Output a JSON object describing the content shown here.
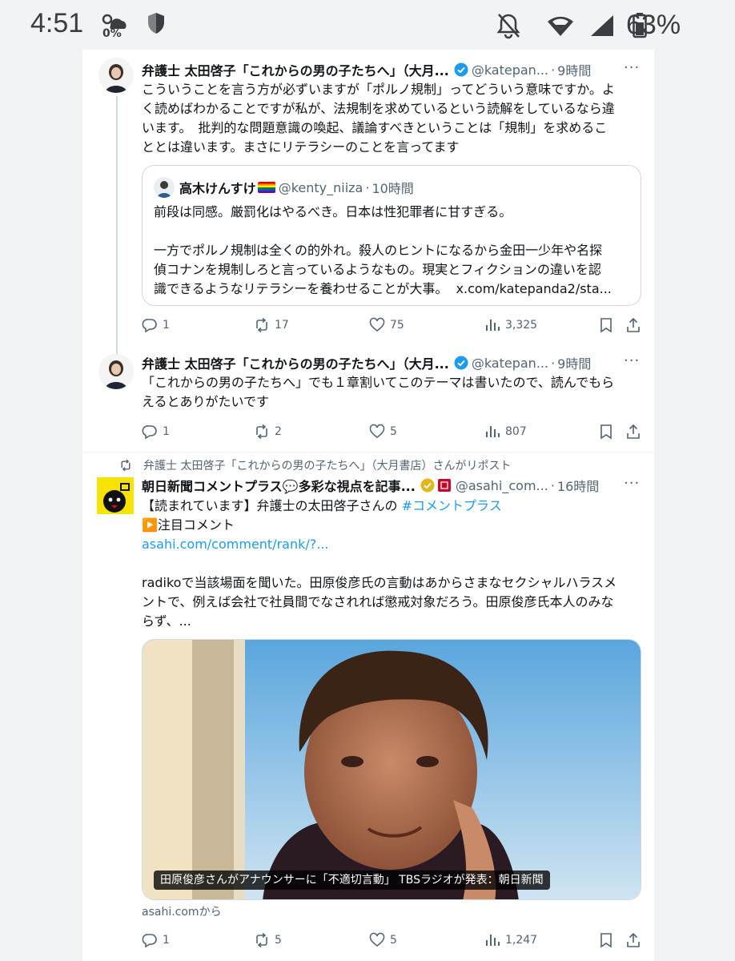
{
  "status_bar": {
    "time": "4:51",
    "weather_percent": "0%",
    "battery_percent": "63%"
  },
  "tweets": [
    {
      "author": "弁護士 太田啓子「これからの男の子たちへ」（大月...",
      "handle": "@katepan...",
      "time": "9時間",
      "lines": [
        "こういうことを言う方が必ずいますが「ポルノ規制」ってどういう意味ですか。よ",
        "く読めばわかることですが私が、法規制を求めているという読解をしているなら違",
        "います。　批判的な問題意識の喚起、議論すべきということは「規制」を求めるこ",
        "ととは違います。まさにリテラシーのことを言ってます"
      ],
      "quote": {
        "author": "高木けんすけ",
        "handle": "@kenty_niiza",
        "time": "10時間",
        "line1": "前段は同感。厳罰化はやるべき。日本は性犯罪者に甘すぎる。",
        "line2": "一方でポルノ規制は全くの的外れ。殺人のヒントになるから金田一少年や名探",
        "line3": "偵コナンを規制しろと言っているようなもの。現実とフィクションの違いを認",
        "line4": "識できるようなリテラシーを養わせることが大事。",
        "link": "x.com/katepanda2/sta..."
      },
      "replies": "1",
      "reposts": "17",
      "likes": "75",
      "views": "3,325"
    },
    {
      "author": "弁護士 太田啓子「これからの男の子たちへ」（大月...",
      "handle": "@katepan...",
      "time": "9時間",
      "lines": [
        "「これからの男の子たちへ」でも１章割いてこのテーマは書いたので、読んでもら",
        "えるとありがたいです"
      ],
      "replies": "1",
      "reposts": "2",
      "likes": "5",
      "views": "807"
    },
    {
      "repost_by": "弁護士 太田啓子「これからの男の子たちへ」（大月書店）さんがリポスト",
      "author": "朝日新聞コメントプラス💬多彩な視点を記事...",
      "handle": "@asahi_com...",
      "time": "16時間",
      "line1_prefix": "【読まれています】弁護士の太田啓子さんの",
      "hashtag": "#コメントプラス",
      "line2": "▶️注目コメント",
      "link": "asahi.com/comment/rank/?...",
      "body1": "radikoで当該場面を聞いた。田原俊彦氏の言動はあからさまなセクシャルハラスメ",
      "body2": "ントで、例えば会社で社員間でなされれば懲戒対象だろう。田原俊彦氏本人のみな",
      "body3": "らず、...",
      "card_caption": "田原俊彦さんがアナウンサーに「不適切言動」 TBSラジオが発表：朝日新聞",
      "card_source": "asahi.comから",
      "replies": "1",
      "reposts": "5",
      "likes": "5",
      "views": "1,247"
    }
  ],
  "colors": {
    "accent": "#1d9bf0",
    "text": "#0f1419",
    "muted": "#536471",
    "border": "#cfd9de"
  }
}
